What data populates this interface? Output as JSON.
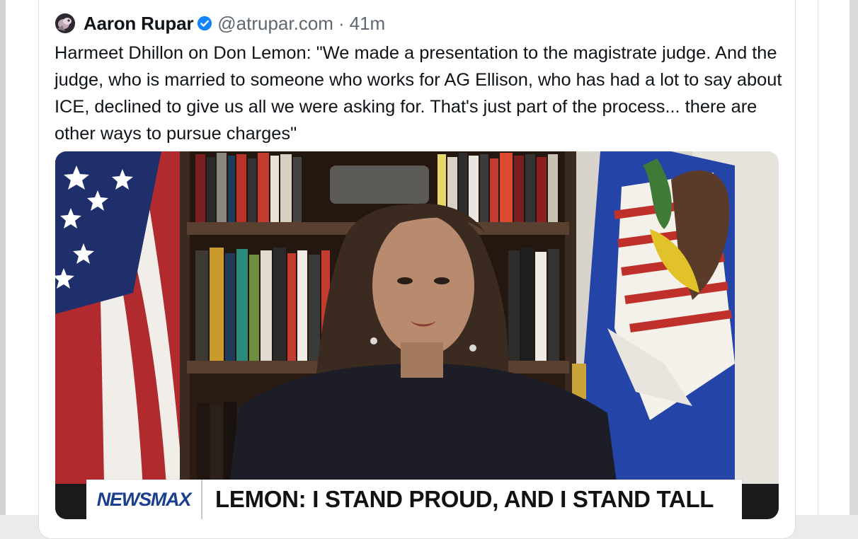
{
  "post": {
    "author": "Aaron Rupar",
    "handle": "@atrupar.com",
    "separator": "·",
    "time": "41m",
    "text": "Harmeet Dhillon on Don Lemon: \"We made a presentation to the magistrate judge. And the judge, who is married to someone who works for AG Ellison, who has had a lot to say about ICE, declined to give us all we were asking for. That's just part of the process... there are other ways to pursue charges\""
  },
  "media": {
    "network": "NEWSMAX",
    "headline": "LEMON: I STAND PROUD, AND I STAND TALL"
  },
  "icons": {
    "avatar": "avatar-image",
    "verified": "verified-badge-icon"
  },
  "colors": {
    "verified_blue": "#1185fe",
    "network_blue": "#1a3f8f",
    "text": "#0f1419",
    "muted": "#5f6770"
  }
}
